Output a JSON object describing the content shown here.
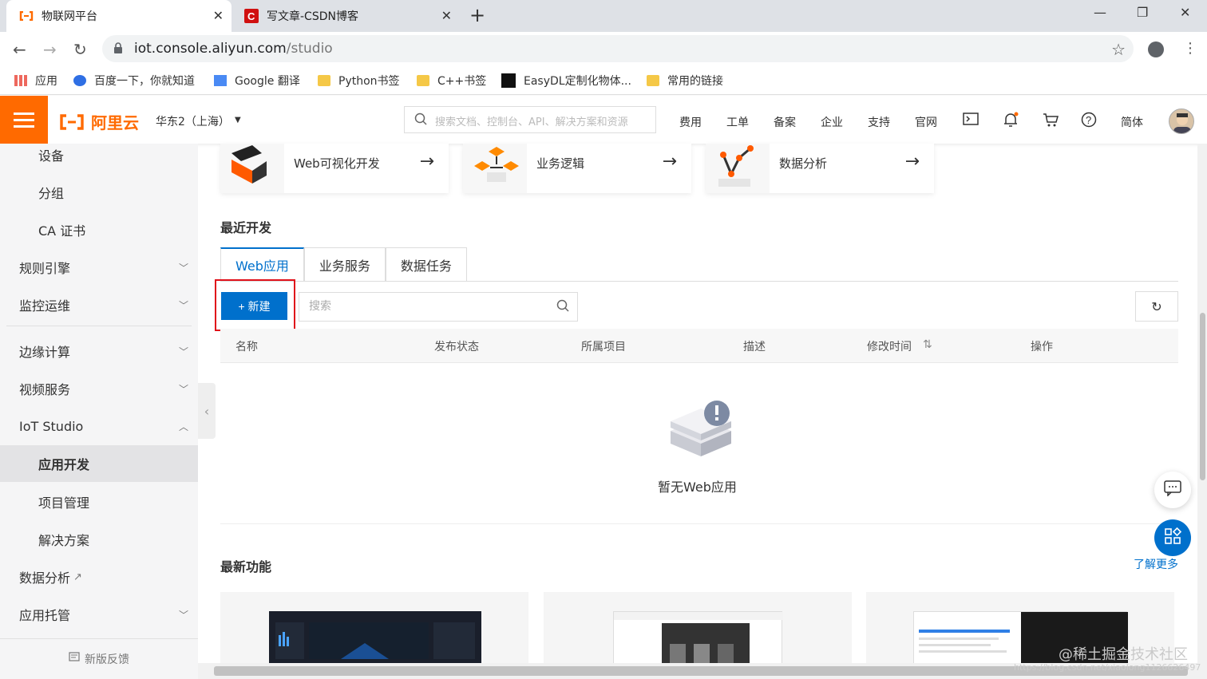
{
  "browser": {
    "tabs": [
      {
        "title": "物联网平台",
        "active": true
      },
      {
        "title": "写文章-CSDN博客",
        "active": false
      }
    ],
    "url_host": "iot.console.aliyun.com",
    "url_path": "/studio",
    "bookmarks": [
      "应用",
      "百度一下，你就知道",
      "Google 翻译",
      "Python书签",
      "C++书签",
      "EasyDL定制化物体...",
      "常用的链接"
    ]
  },
  "header": {
    "logo_text": "阿里云",
    "region": "华东2（上海）",
    "search_placeholder": "搜索文档、控制台、API、解决方案和资源",
    "nav": [
      "费用",
      "工单",
      "备案",
      "企业",
      "支持",
      "官网"
    ],
    "language": "简体",
    "accent": "#ff6a00"
  },
  "sidebar": {
    "items": [
      {
        "label": "设备",
        "level": "sub"
      },
      {
        "label": "分组",
        "level": "sub"
      },
      {
        "label": "CA 证书",
        "level": "sub"
      },
      {
        "label": "规则引擎",
        "level": "top"
      },
      {
        "label": "监控运维",
        "level": "top"
      },
      {
        "label": "边缘计算",
        "level": "top"
      },
      {
        "label": "视频服务",
        "level": "top"
      },
      {
        "label": "IoT Studio",
        "level": "top"
      },
      {
        "label": "应用开发",
        "level": "sub",
        "active": true
      },
      {
        "label": "项目管理",
        "level": "sub"
      },
      {
        "label": "解决方案",
        "level": "sub"
      },
      {
        "label": "数据分析",
        "level": "top"
      },
      {
        "label": "应用托管",
        "level": "top"
      }
    ],
    "feedback": "新版反馈"
  },
  "main": {
    "cards": [
      "Web可视化开发",
      "业务逻辑",
      "数据分析"
    ],
    "recent_title": "最近开发",
    "tabs": [
      "Web应用",
      "业务服务",
      "数据任务"
    ],
    "new_button": "+ 新建",
    "search_placeholder": "搜索",
    "columns": [
      "名称",
      "发布状态",
      "所属项目",
      "描述",
      "修改时间",
      "操作"
    ],
    "empty_text": "暂无Web应用",
    "latest_title": "最新功能",
    "more_link": "了解更多",
    "primary_color": "#0070cc",
    "highlight_color": "#e0101a"
  },
  "watermark": "@稀土掘金技术社区",
  "watermark_url": "https://blog.csdn.net/xiaolong1126626497"
}
